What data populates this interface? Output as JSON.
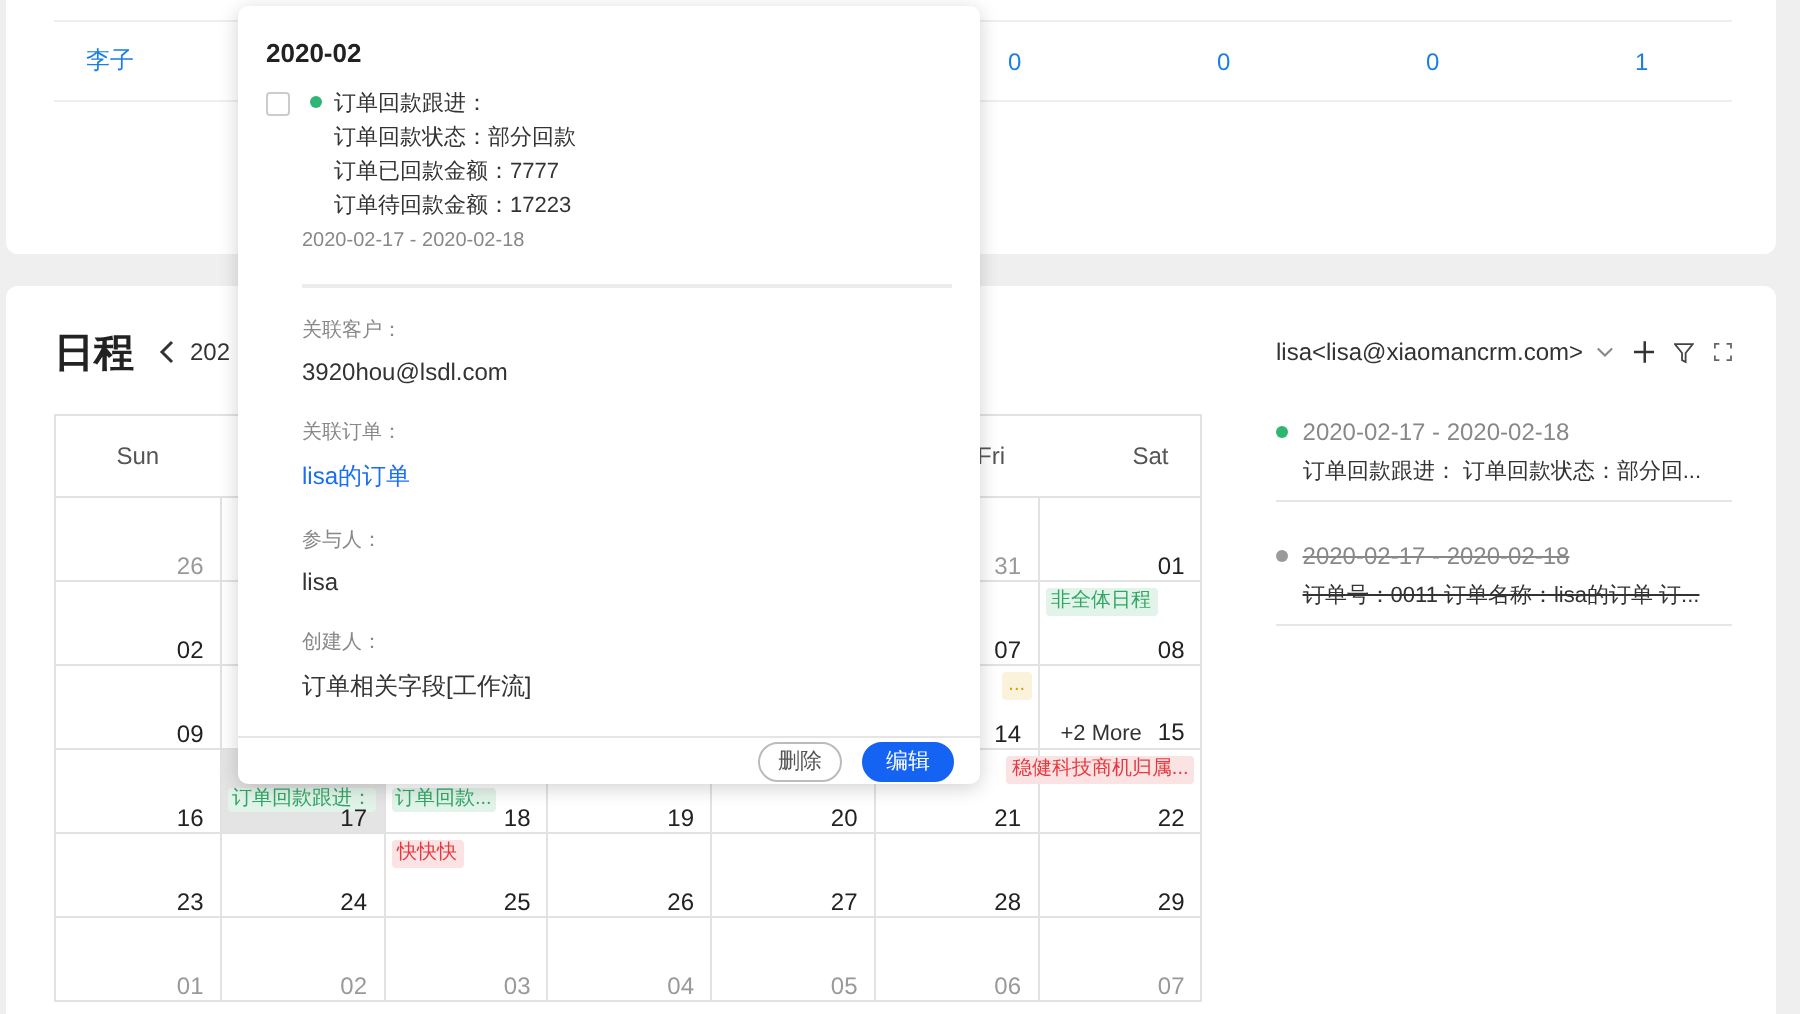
{
  "top_table": {
    "row": {
      "name": "李子",
      "cells": [
        "0",
        "0",
        "0",
        "1"
      ]
    }
  },
  "schedule": {
    "title": "日程",
    "period": "202",
    "account": "lisa<lisa@xiaomancrm.com>",
    "weekdays": [
      {
        "label": "Sun"
      },
      {
        "label": "Fri"
      },
      {
        "label": "Sat"
      }
    ],
    "weeks": [
      {
        "cells": [
          {
            "date": "26",
            "muted": true
          },
          {},
          {},
          {},
          {},
          {
            "date": "31",
            "muted": true
          },
          {
            "date": "01",
            "muted": false
          }
        ]
      },
      {
        "cells": [
          {
            "date": "02",
            "muted": false
          },
          {},
          {},
          {},
          {},
          {
            "date": "07",
            "muted": false
          },
          {
            "date": "08",
            "muted": false,
            "events": [
              {
                "text": "非全体日程",
                "color": "#2fa864",
                "end": false,
                "lower": false
              }
            ]
          }
        ]
      },
      {
        "cells": [
          {
            "date": "09",
            "muted": false
          },
          {},
          {},
          {},
          {},
          {
            "date": "14",
            "muted": false,
            "events": [
              {
                "text": "...",
                "color": "#d9a000",
                "end": true,
                "lower": false
              }
            ]
          },
          {
            "date": "15",
            "muted": false,
            "more": "+2 More"
          }
        ]
      },
      {
        "cells": [
          {
            "date": "16",
            "muted": false
          },
          {
            "date": "17",
            "muted": false,
            "highlighted": true,
            "events": [
              {
                "text": "订单回款跟进：",
                "color": "#2fa864",
                "end": false,
                "lower": true
              }
            ]
          },
          {
            "date": "18",
            "muted": false,
            "events": [
              {
                "text": "订单回款...",
                "color": "#2fa864",
                "end": false,
                "lower": true
              }
            ]
          },
          {
            "date": "19",
            "muted": false
          },
          {
            "date": "20",
            "muted": false
          },
          {
            "date": "21",
            "muted": false
          },
          {
            "date": "22",
            "muted": false,
            "events": [
              {
                "text": "稳健科技商机归属...",
                "color": "#e5393f",
                "end": true,
                "lower": false
              }
            ]
          }
        ]
      },
      {
        "cells": [
          {
            "date": "23",
            "muted": false
          },
          {
            "date": "24",
            "muted": false
          },
          {
            "date": "25",
            "muted": false,
            "events": [
              {
                "text": "快快快",
                "color": "#e5393f",
                "end": false,
                "lower": false
              }
            ]
          },
          {
            "date": "26",
            "muted": false
          },
          {
            "date": "27",
            "muted": false
          },
          {
            "date": "28",
            "muted": false
          },
          {
            "date": "29",
            "muted": false
          }
        ]
      },
      {
        "cells": [
          {
            "date": "01",
            "muted": true
          },
          {
            "date": "02",
            "muted": true
          },
          {
            "date": "03",
            "muted": true
          },
          {
            "date": "04",
            "muted": true
          },
          {
            "date": "05",
            "muted": true
          },
          {
            "date": "06",
            "muted": true
          },
          {
            "date": "07",
            "muted": true
          }
        ]
      }
    ],
    "agenda": [
      {
        "date": "2020-02-17 - 2020-02-18",
        "text": "订单回款跟进： 订单回款状态：部分回...",
        "color": "#2fb574",
        "done": false
      },
      {
        "date": "2020-02-17 - 2020-02-18",
        "text": "订单号：0011 订单名称：lisa的订单 订...",
        "color": "#9a9a9a",
        "done": true
      }
    ]
  },
  "popover": {
    "title": "2020-02",
    "event": {
      "checked": false,
      "color": "#2fb574",
      "lines": [
        "订单回款跟进：",
        "订单回款状态：部分回款",
        "订单已回款金额：7777",
        "订单待回款金额：17223"
      ],
      "date": "2020-02-17 - 2020-02-18"
    },
    "fields": [
      {
        "label": "关联客户：",
        "value": "3920hou@lsdl.com",
        "kind": "text"
      },
      {
        "label": "关联订单：",
        "value": "lisa的订单",
        "kind": "link"
      },
      {
        "label": "参与人：",
        "value": "lisa",
        "kind": "text"
      },
      {
        "label": "创建人：",
        "value": "订单相关字段[工作流]",
        "kind": "text"
      }
    ],
    "buttons": [
      {
        "label": "删除",
        "kind": "secondary"
      },
      {
        "label": "编辑",
        "kind": "primary"
      }
    ]
  }
}
